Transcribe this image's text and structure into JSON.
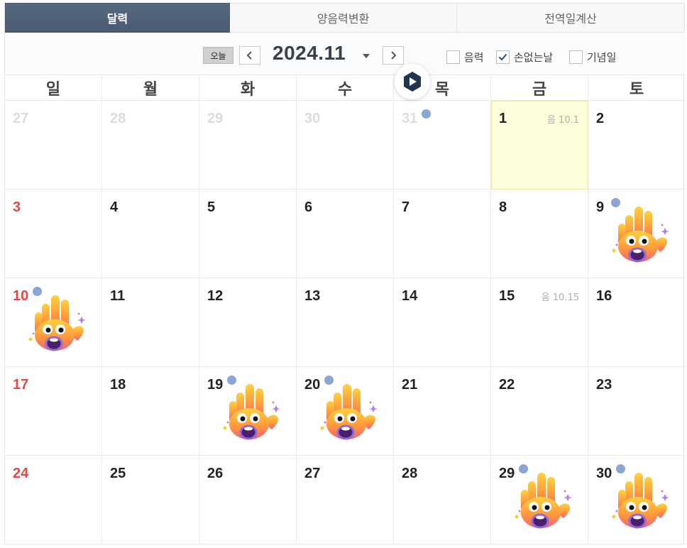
{
  "tabs": [
    {
      "label": "달력",
      "active": true
    },
    {
      "label": "양음력변환",
      "active": false
    },
    {
      "label": "전역일계산",
      "active": false
    }
  ],
  "toolbar": {
    "today_label": "오늘",
    "month_label": "2024.11",
    "options": [
      {
        "label": "음력",
        "checked": false
      },
      {
        "label": "손없는날",
        "checked": true
      },
      {
        "label": "기념일",
        "checked": false
      }
    ]
  },
  "weekdays": [
    "일",
    "월",
    "화",
    "수",
    "목",
    "금",
    "토"
  ],
  "weeks": [
    [
      {
        "day": "27",
        "other_month": true
      },
      {
        "day": "28",
        "other_month": true
      },
      {
        "day": "29",
        "other_month": true
      },
      {
        "day": "30",
        "other_month": true
      },
      {
        "day": "31",
        "other_month": true,
        "dot": true
      },
      {
        "day": "1",
        "today": true,
        "lunar": "음 10.1"
      },
      {
        "day": "2"
      }
    ],
    [
      {
        "day": "3"
      },
      {
        "day": "4"
      },
      {
        "day": "5"
      },
      {
        "day": "6"
      },
      {
        "day": "7"
      },
      {
        "day": "8"
      },
      {
        "day": "9",
        "dot": true,
        "no_ghost": true
      }
    ],
    [
      {
        "day": "10",
        "dot": true,
        "no_ghost": true
      },
      {
        "day": "11"
      },
      {
        "day": "12"
      },
      {
        "day": "13"
      },
      {
        "day": "14"
      },
      {
        "day": "15",
        "lunar": "음 10.15"
      },
      {
        "day": "16"
      }
    ],
    [
      {
        "day": "17"
      },
      {
        "day": "18"
      },
      {
        "day": "19",
        "dot": true,
        "no_ghost": true
      },
      {
        "day": "20",
        "dot": true,
        "no_ghost": true
      },
      {
        "day": "21"
      },
      {
        "day": "22"
      },
      {
        "day": "23"
      }
    ],
    [
      {
        "day": "24"
      },
      {
        "day": "25"
      },
      {
        "day": "26"
      },
      {
        "day": "27"
      },
      {
        "day": "28"
      },
      {
        "day": "29",
        "dot": true,
        "no_ghost": true
      },
      {
        "day": "30",
        "dot": true,
        "no_ghost": true
      }
    ]
  ],
  "icons": {
    "prev": "chevron-left-icon",
    "next": "chevron-right-icon",
    "dropdown": "caret-down-icon",
    "no_ghost_day": "waving-hand-emoji-icon",
    "event_dot": "event-dot-icon",
    "overlay": "play-badge-icon"
  },
  "colors": {
    "tab_active": "#4a5b71",
    "sunday": "#e64545",
    "today_bg": "#fefdd9",
    "dot": "#8aa5d6",
    "other_month": "#dcdcdc"
  }
}
